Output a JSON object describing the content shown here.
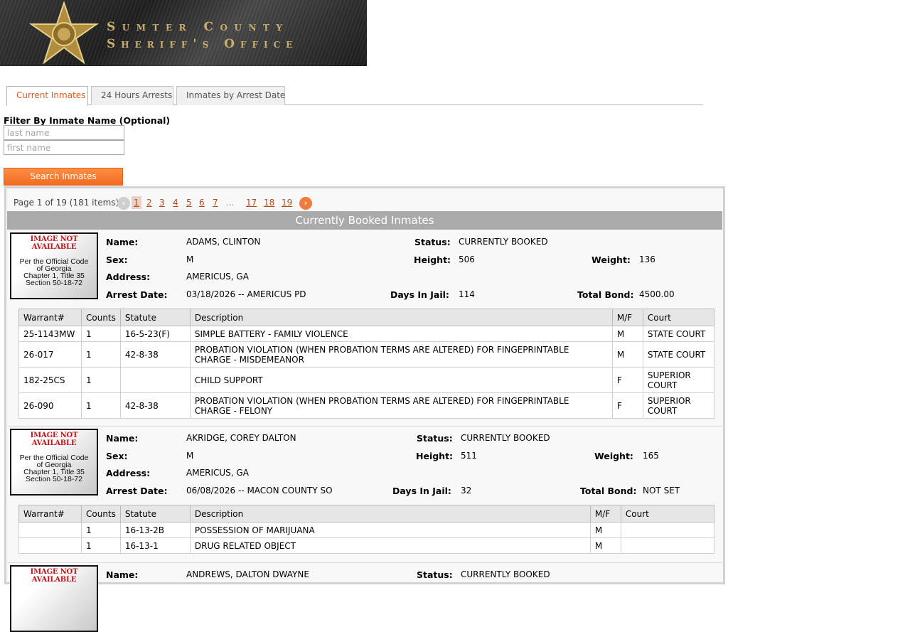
{
  "banner": {
    "line1": "Sumter County",
    "line2": "Sheriff's Office",
    "badge_icon": "sheriff-star-icon"
  },
  "tabs": [
    {
      "label": "Current Inmates",
      "active": true
    },
    {
      "label": "24 Hours Arrests",
      "active": false
    },
    {
      "label": "Inmates by Arrest Date",
      "active": false
    }
  ],
  "filter": {
    "label": "Filter By Inmate Name (Optional)",
    "last_placeholder": "last name",
    "first_placeholder": "first name",
    "search_label": "Search Inmates"
  },
  "pager": {
    "info": "Page 1 of 19 (181 items)",
    "prev_icon": "chevron-left-icon",
    "next_icon": "chevron-right-icon",
    "pages": [
      "1",
      "2",
      "3",
      "4",
      "5",
      "6",
      "7",
      "...",
      "17",
      "18",
      "19"
    ]
  },
  "grid_title": "Currently Booked Inmates",
  "labels": {
    "name": "Name:",
    "status": "Status:",
    "sex": "Sex:",
    "height": "Height:",
    "weight": "Weight:",
    "address": "Address:",
    "arrest_date": "Arrest Date:",
    "days": "Days In Jail:",
    "bond": "Total Bond:"
  },
  "photo": {
    "na": "IMAGE NOT AVAILABLE",
    "code1": "Per the Official Code",
    "code2": "of Georgia",
    "code3": "Chapter 1, Title 35",
    "code4": "Section 50-18-72"
  },
  "columns": [
    "Warrant#",
    "Counts",
    "Statute",
    "Description",
    "M/F",
    "Court"
  ],
  "inmates": [
    {
      "name": "ADAMS, CLINTON",
      "status": "CURRENTLY BOOKED",
      "sex": "M",
      "height": "506",
      "weight": "136",
      "address": "AMERICUS, GA",
      "arrest": "03/18/2026 -- AMERICUS PD",
      "days": "114",
      "bond": "4500.00",
      "charges": [
        [
          "25-1143MW",
          "1",
          "16-5-23(F)",
          "SIMPLE BATTERY - FAMILY VIOLENCE",
          "M",
          "STATE COURT"
        ],
        [
          "26-017",
          "1",
          "42-8-38",
          "PROBATION VIOLATION (WHEN PROBATION TERMS ARE ALTERED) FOR FINGEPRINTABLE CHARGE - MISDEMEANOR",
          "M",
          "STATE COURT"
        ],
        [
          "182-25CS",
          "1",
          "",
          "CHILD SUPPORT",
          "F",
          "SUPERIOR COURT"
        ],
        [
          "26-090",
          "1",
          "42-8-38",
          "PROBATION VIOLATION (WHEN PROBATION TERMS ARE ALTERED) FOR FINGEPRINTABLE CHARGE - FELONY",
          "F",
          "SUPERIOR COURT"
        ]
      ]
    },
    {
      "name": "AKRIDGE, COREY DALTON",
      "status": "CURRENTLY BOOKED",
      "sex": "M",
      "height": "511",
      "weight": "165",
      "address": "AMERICUS, GA",
      "arrest": "06/08/2026 -- MACON COUNTY SO",
      "days": "32",
      "bond": "NOT SET",
      "charges": [
        [
          "",
          "1",
          "16-13-2B",
          "POSSESSION OF MARIJUANA",
          "M",
          ""
        ],
        [
          "",
          "1",
          "16-13-1",
          "DRUG RELATED OBJECT",
          "M",
          ""
        ]
      ]
    },
    {
      "name": "ANDREWS, DALTON DWAYNE",
      "status": "CURRENTLY BOOKED"
    }
  ]
}
